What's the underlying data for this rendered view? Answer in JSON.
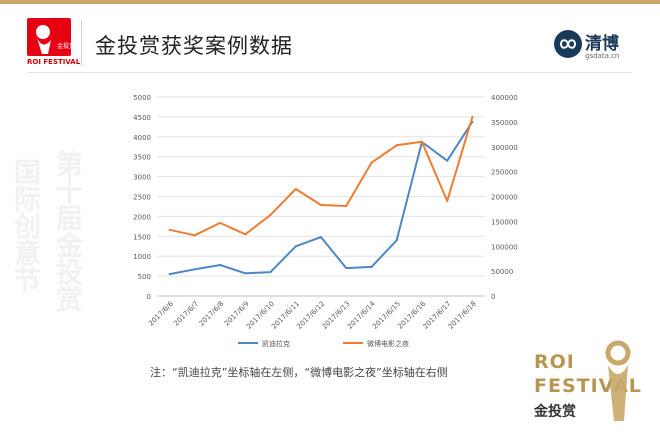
{
  "header": {
    "title": "金投赏获奖案例数据",
    "logo_left_text": "ROI FESTIVAL",
    "logo_left_badge": "金投赏",
    "logo_right_name": "清博",
    "logo_right_sub": "gsdata.cn"
  },
  "watermark": [
    "第十届金投赏",
    "国际创意节"
  ],
  "note": "注：“凯迪拉克”坐标轴在左侧，“微博电影之夜”坐标轴在右侧",
  "brand": {
    "line1": "ROI",
    "line2": "FESTIVAL",
    "cn": "金投赏"
  },
  "colors": {
    "accent_gold": "#c9a86a",
    "logo_red": "#e60012",
    "series1": "#4f86c6",
    "series2": "#ed7d31"
  },
  "chart_data": {
    "type": "line",
    "title": "",
    "categories": [
      "2017/6/6",
      "2017/6/7",
      "2017/6/8",
      "2017/6/9",
      "2017/6/10",
      "2017/6/11",
      "2017/6/12",
      "2017/6/13",
      "2017/6/14",
      "2017/6/15",
      "2017/6/16",
      "2017/6/17",
      "2017/6/18"
    ],
    "y_left": {
      "ticks": [
        "0",
        "500",
        "1000",
        "1500",
        "2000",
        "2500",
        "3000",
        "3500",
        "4000",
        "4500",
        "5000"
      ],
      "lim": [
        0,
        5000
      ]
    },
    "y_right": {
      "ticks": [
        "0",
        "50000",
        "100000",
        "150000",
        "200000",
        "250000",
        "300000",
        "350000",
        "400000"
      ],
      "lim": [
        0,
        400000
      ]
    },
    "grid": true,
    "legend_position": "bottom",
    "series": [
      {
        "name": "凯迪拉克",
        "axis": "left",
        "color": "#4f86c6",
        "values": [
          550,
          670,
          780,
          570,
          600,
          1250,
          1480,
          700,
          730,
          1400,
          3870,
          3400,
          4380
        ]
      },
      {
        "name": "微博电影之夜",
        "axis": "right",
        "color": "#ed7d31",
        "values": [
          133000,
          122000,
          147000,
          124000,
          163000,
          215000,
          183000,
          181000,
          268000,
          303000,
          310000,
          191000,
          360000
        ]
      }
    ]
  }
}
